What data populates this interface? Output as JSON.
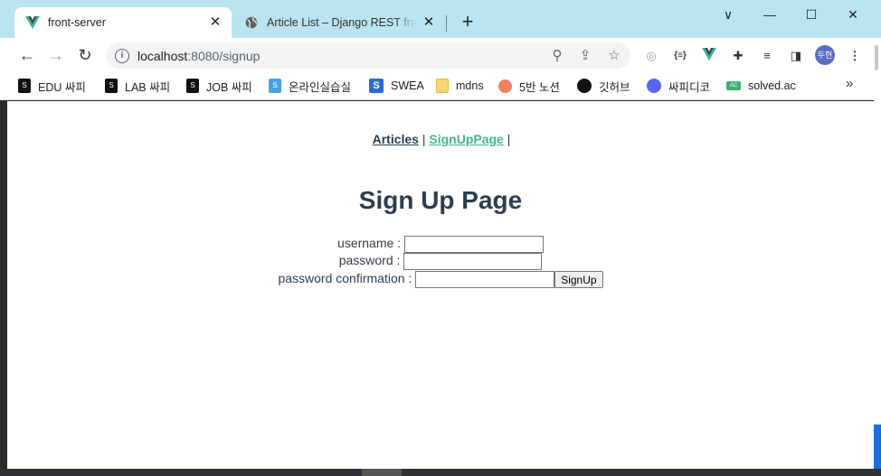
{
  "browser": {
    "tabs": [
      {
        "title": "front-server",
        "active": true,
        "favicon": "vue-logo-icon"
      },
      {
        "title": "Article List – Django REST framework",
        "active": false,
        "favicon": "globe-icon"
      }
    ],
    "new_tab": "+",
    "window_controls": {
      "menu": "∨",
      "minimize": "—",
      "maximize": "☐",
      "close": "✕"
    },
    "address": {
      "host": "localhost",
      "path": ":8080/signup"
    },
    "profile_initials": "두현",
    "bookmarks": [
      {
        "label": "EDU 싸피",
        "icon": "ssafy-icon",
        "color": "#111111"
      },
      {
        "label": "LAB 싸피",
        "icon": "ssafy-icon",
        "color": "#111111"
      },
      {
        "label": "JOB 싸피",
        "icon": "ssafy-icon",
        "color": "#111111"
      },
      {
        "label": "온라인실습실",
        "icon": "ssafy-icon",
        "color": "#4aa3df"
      },
      {
        "label": "SWEA",
        "icon": "swea-icon",
        "color": "#2b6cd4"
      },
      {
        "label": "mdns",
        "icon": "folder-icon",
        "color": "#f5d76e"
      },
      {
        "label": "5반 노션",
        "icon": "peach-icon",
        "color": "#f08060"
      },
      {
        "label": "깃허브",
        "icon": "github-icon",
        "color": "#111111"
      },
      {
        "label": "싸피디코",
        "icon": "discord-icon",
        "color": "#5865f2"
      },
      {
        "label": "solved.ac",
        "icon": "solvedac-icon",
        "color": "#3cb371"
      }
    ],
    "more": "»"
  },
  "page": {
    "nav": {
      "articles": "Articles",
      "sep1": " | ",
      "signup": "SignUpPage",
      "sep2": " |"
    },
    "title": "Sign Up Page",
    "form": {
      "username_label": "username : ",
      "password_label": "password : ",
      "confirm_label": "password confirmation : ",
      "submit_label": "SignUp",
      "username_value": "",
      "password_value": "",
      "confirm_value": ""
    }
  },
  "colors": {
    "tabstrip": "#b9e4f0",
    "link": "#2c3e50",
    "active_link": "#42b983"
  }
}
